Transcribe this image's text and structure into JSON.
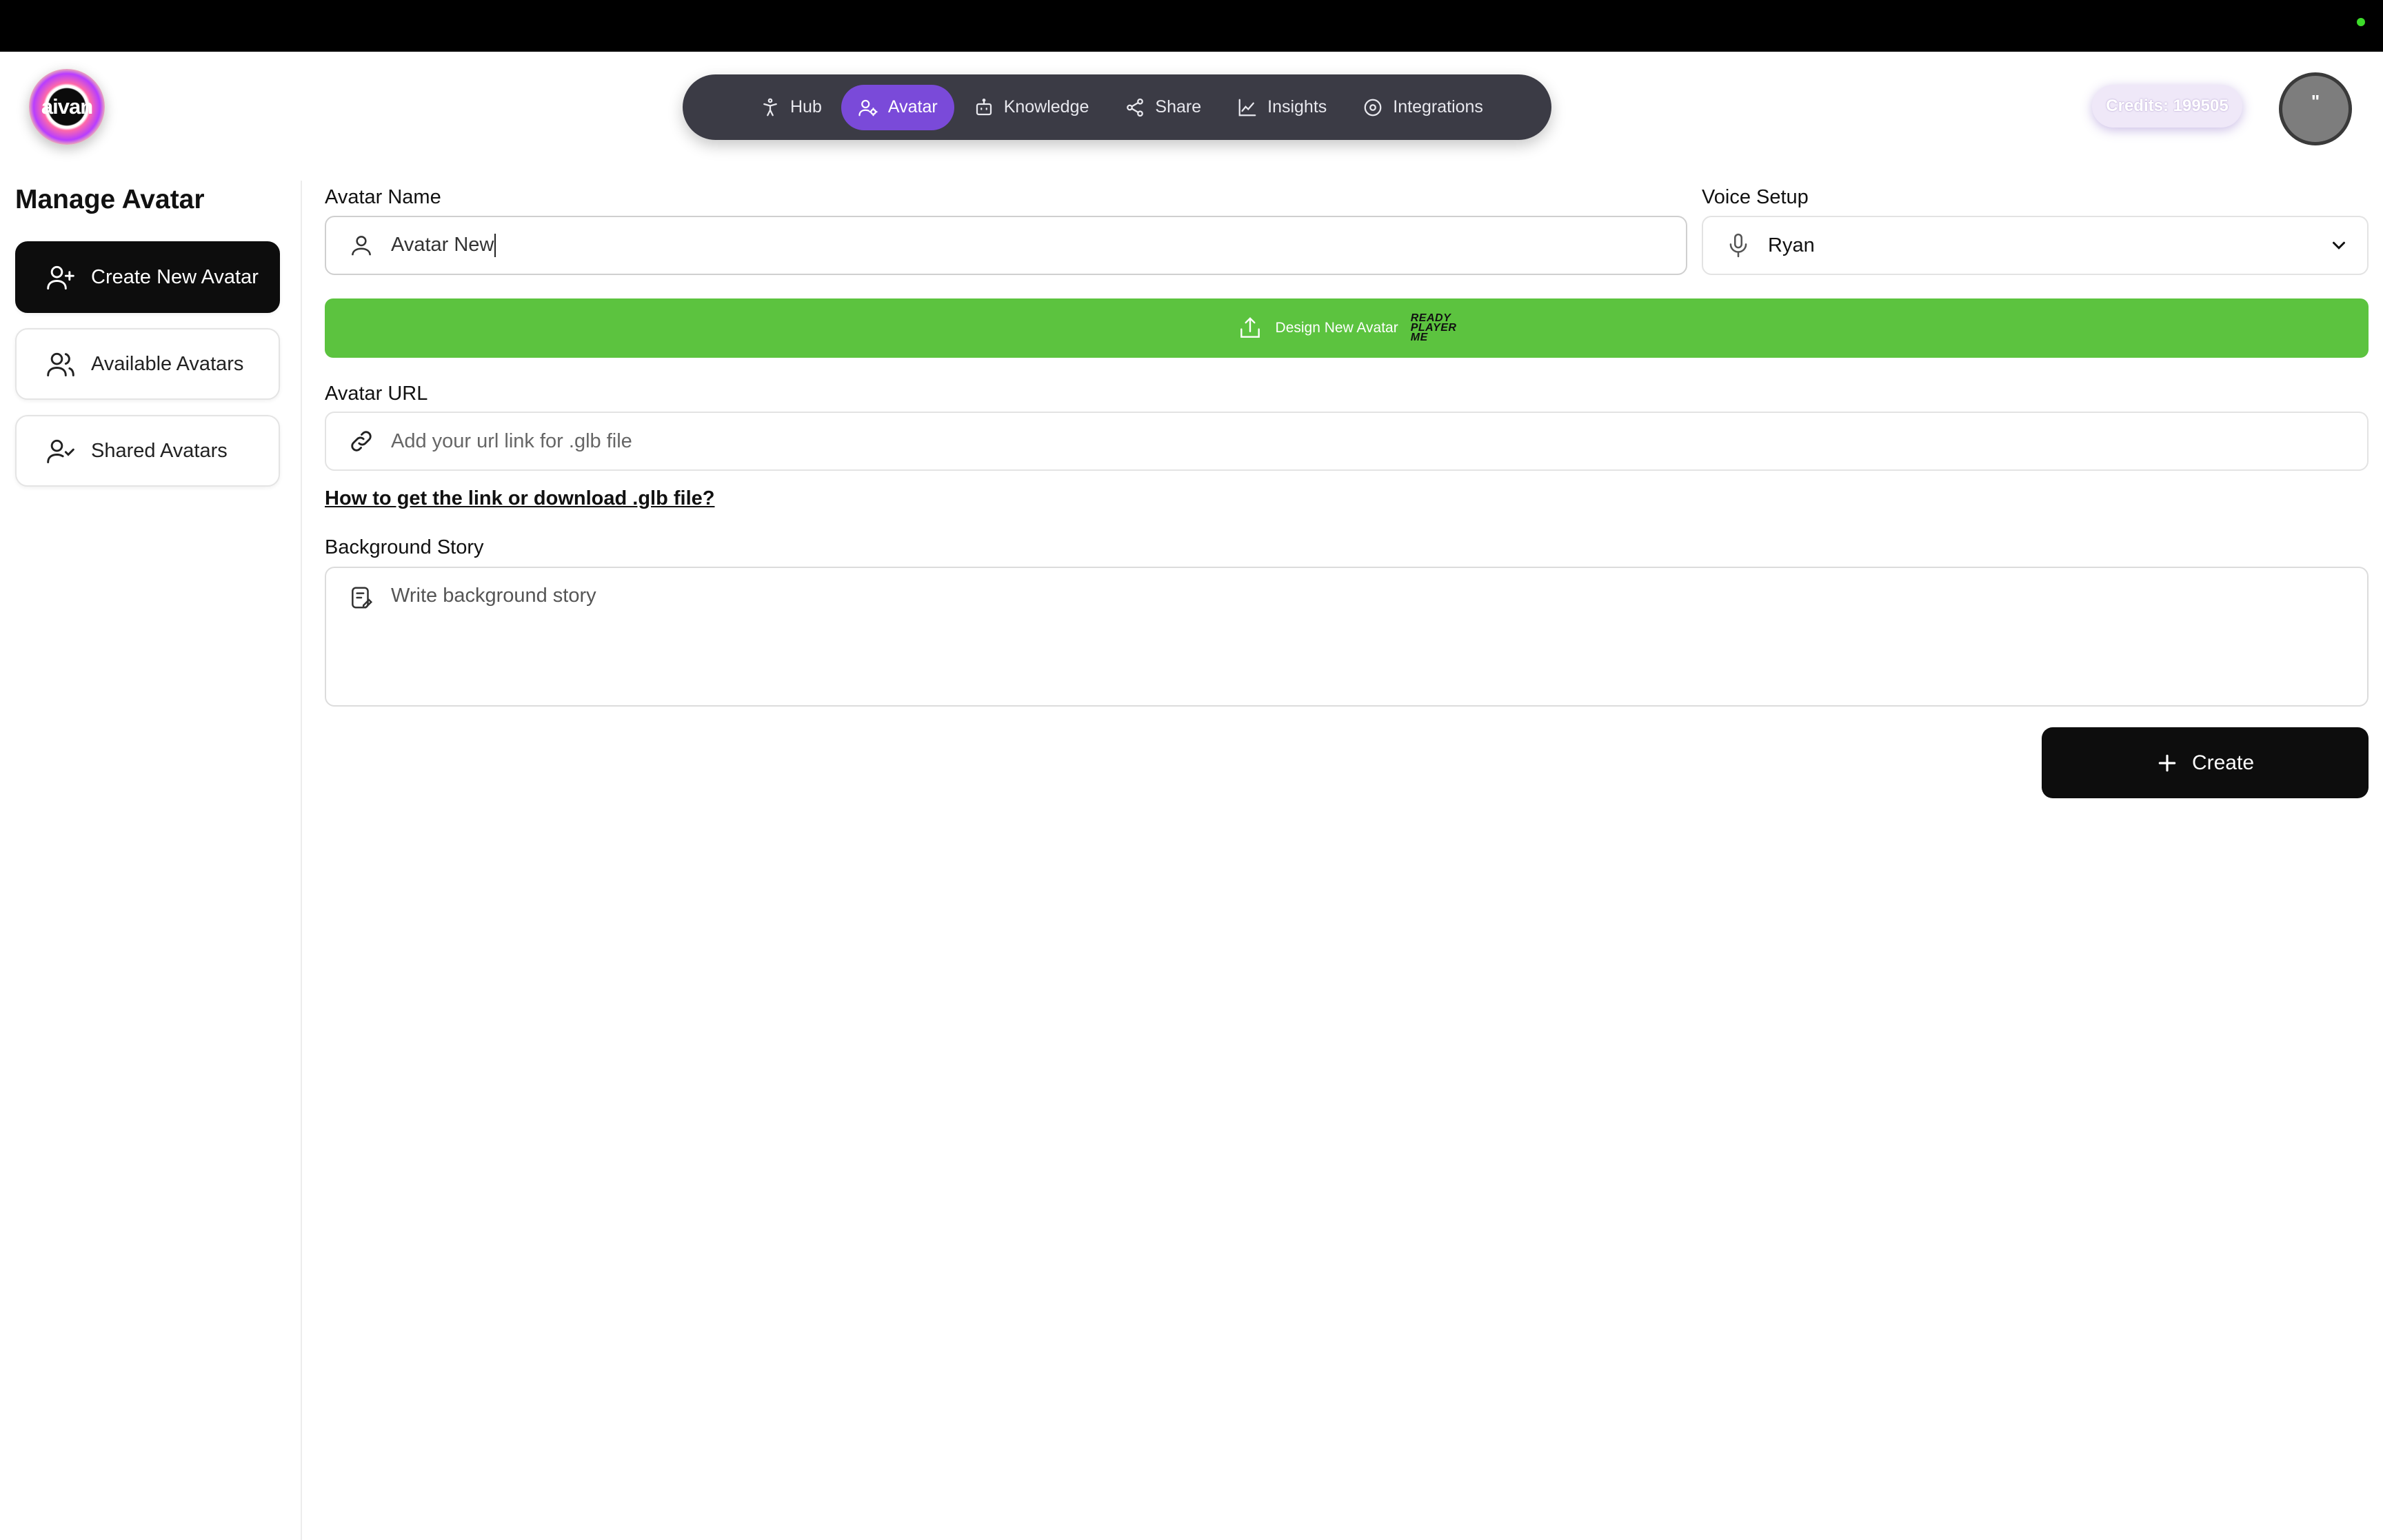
{
  "logo": {
    "text": "aivan"
  },
  "nav": {
    "items": [
      {
        "label": "Hub",
        "icon": "person-stretch-icon"
      },
      {
        "label": "Avatar",
        "icon": "user-gear-icon",
        "active": true
      },
      {
        "label": "Knowledge",
        "icon": "robot-icon"
      },
      {
        "label": "Share",
        "icon": "share-icon"
      },
      {
        "label": "Insights",
        "icon": "chart-line-icon"
      },
      {
        "label": "Integrations",
        "icon": "gear-icon"
      }
    ]
  },
  "credits": {
    "label": "Credits: 199505"
  },
  "profile": {
    "initials": "\""
  },
  "sidebar": {
    "title": "Manage Avatar",
    "items": [
      {
        "label": "Create New Avatar",
        "icon": "user-plus-icon",
        "active": true
      },
      {
        "label": "Available Avatars",
        "icon": "users-icon"
      },
      {
        "label": "Shared Avatars",
        "icon": "user-check-icon"
      }
    ]
  },
  "form": {
    "avatar_name_label": "Avatar Name",
    "avatar_name_value": "Avatar New",
    "voice_label": "Voice Setup",
    "voice_value": "Ryan",
    "design_button_label": "Design New Avatar",
    "design_button_brand": [
      "READY",
      "PLAYER",
      "ME"
    ],
    "avatar_url_label": "Avatar URL",
    "avatar_url_placeholder": "Add your url link for .glb file",
    "help_link": "How to get the link or download .glb file?",
    "story_label": "Background Story",
    "story_placeholder": "Write background story",
    "create_label": "Create"
  },
  "colors": {
    "nav_bg": "#3b3b45",
    "nav_active": "#7a4ad9",
    "green_button": "#5cc33f",
    "dark_button": "#0d0d0d"
  }
}
